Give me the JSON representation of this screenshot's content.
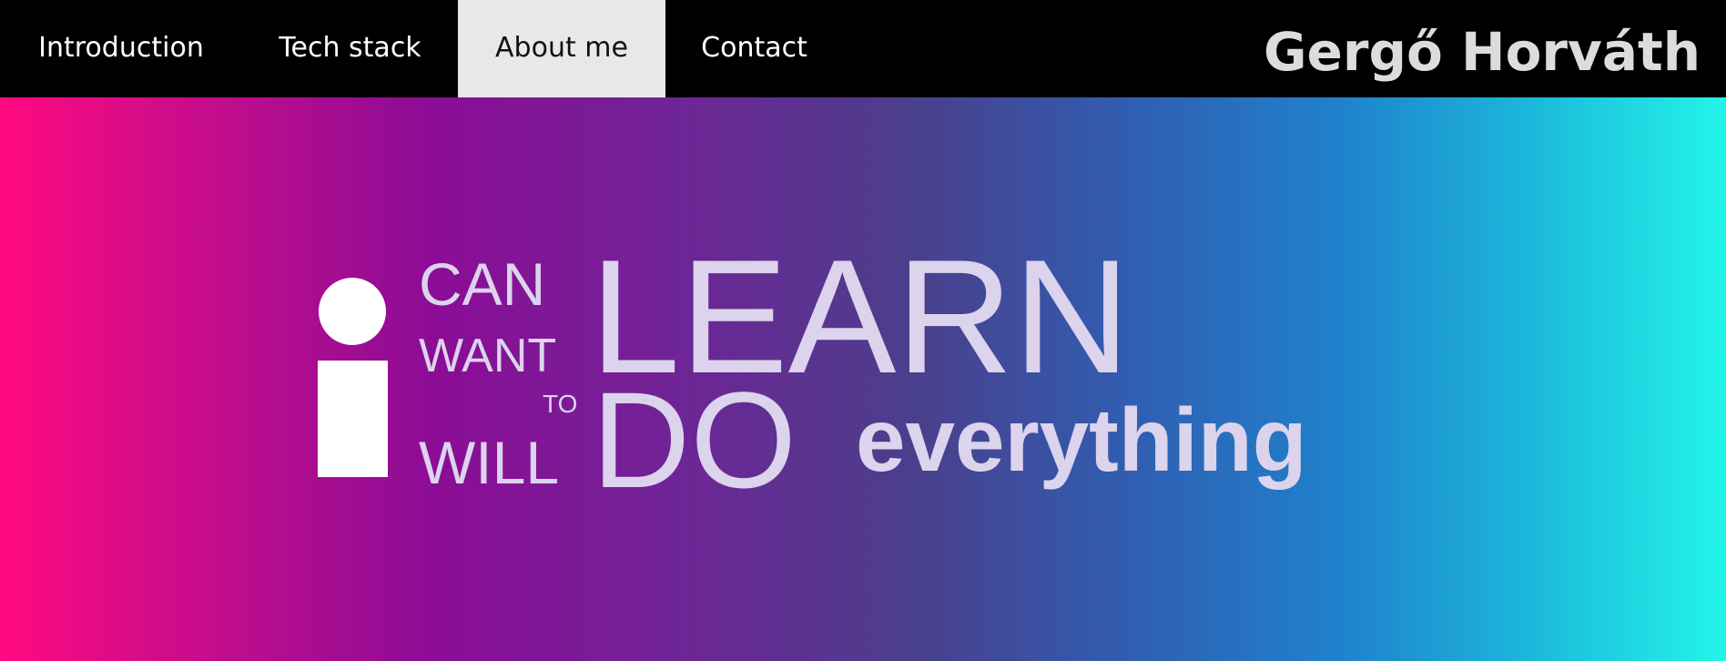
{
  "nav": {
    "items": [
      {
        "label": "Introduction"
      },
      {
        "label": "Tech stack"
      },
      {
        "label": "About me"
      },
      {
        "label": "Contact"
      }
    ],
    "active": "About me"
  },
  "brand": {
    "name": "Gergő Horváth"
  },
  "hero": {
    "gradient_colors": [
      "#ff0a80",
      "#8c0c96",
      "#4a3f8c",
      "#1f83cd",
      "#22f5e8"
    ],
    "text_color": "#dcd3ec",
    "slogan": {
      "modal_1": "CAN",
      "modal_2": "WANT",
      "to": "TO",
      "modal_3": "WILL",
      "verb_1": "LEARN",
      "verb_2": "DO",
      "object": "everything"
    }
  }
}
